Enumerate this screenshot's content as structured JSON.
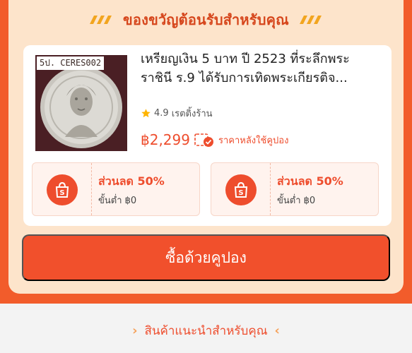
{
  "header": {
    "title": "ของขวัญต้อนรับสำหรับคุณ",
    "deco_icon": "double-chevron-decoration"
  },
  "product": {
    "image_label": "5ป. CERES002",
    "title_line1": "เหรียญเงิน 5 บาท ปี 2523 ที่ระลึกพระ",
    "title_line2": "ราชินี ร.9 ได้รับการเทิดพระเกียรติจ...",
    "rating": "4.9",
    "rating_label": "เรตติ้งร้าน",
    "price": "฿2,299",
    "price_note": "ราคาหลังใช้คูปอง"
  },
  "coupons": [
    {
      "discount": "ส่วนลด 50%",
      "min_spend": "ขั้นต่ำ ฿0",
      "icon": "shopee-bag-icon"
    },
    {
      "discount": "ส่วนลด 50%",
      "min_spend": "ขั้นต่ำ ฿0",
      "icon": "shopee-bag-icon"
    }
  ],
  "cta": {
    "label": "ซื้อด้วยคูปอง"
  },
  "footer": {
    "label": "สินค้าแนะนำสำหรับคุณ"
  },
  "colors": {
    "brand": "#ee4d2d",
    "promo_background": "#f25c2b",
    "card_background": "#fde4cb",
    "star": "#ffb400"
  }
}
